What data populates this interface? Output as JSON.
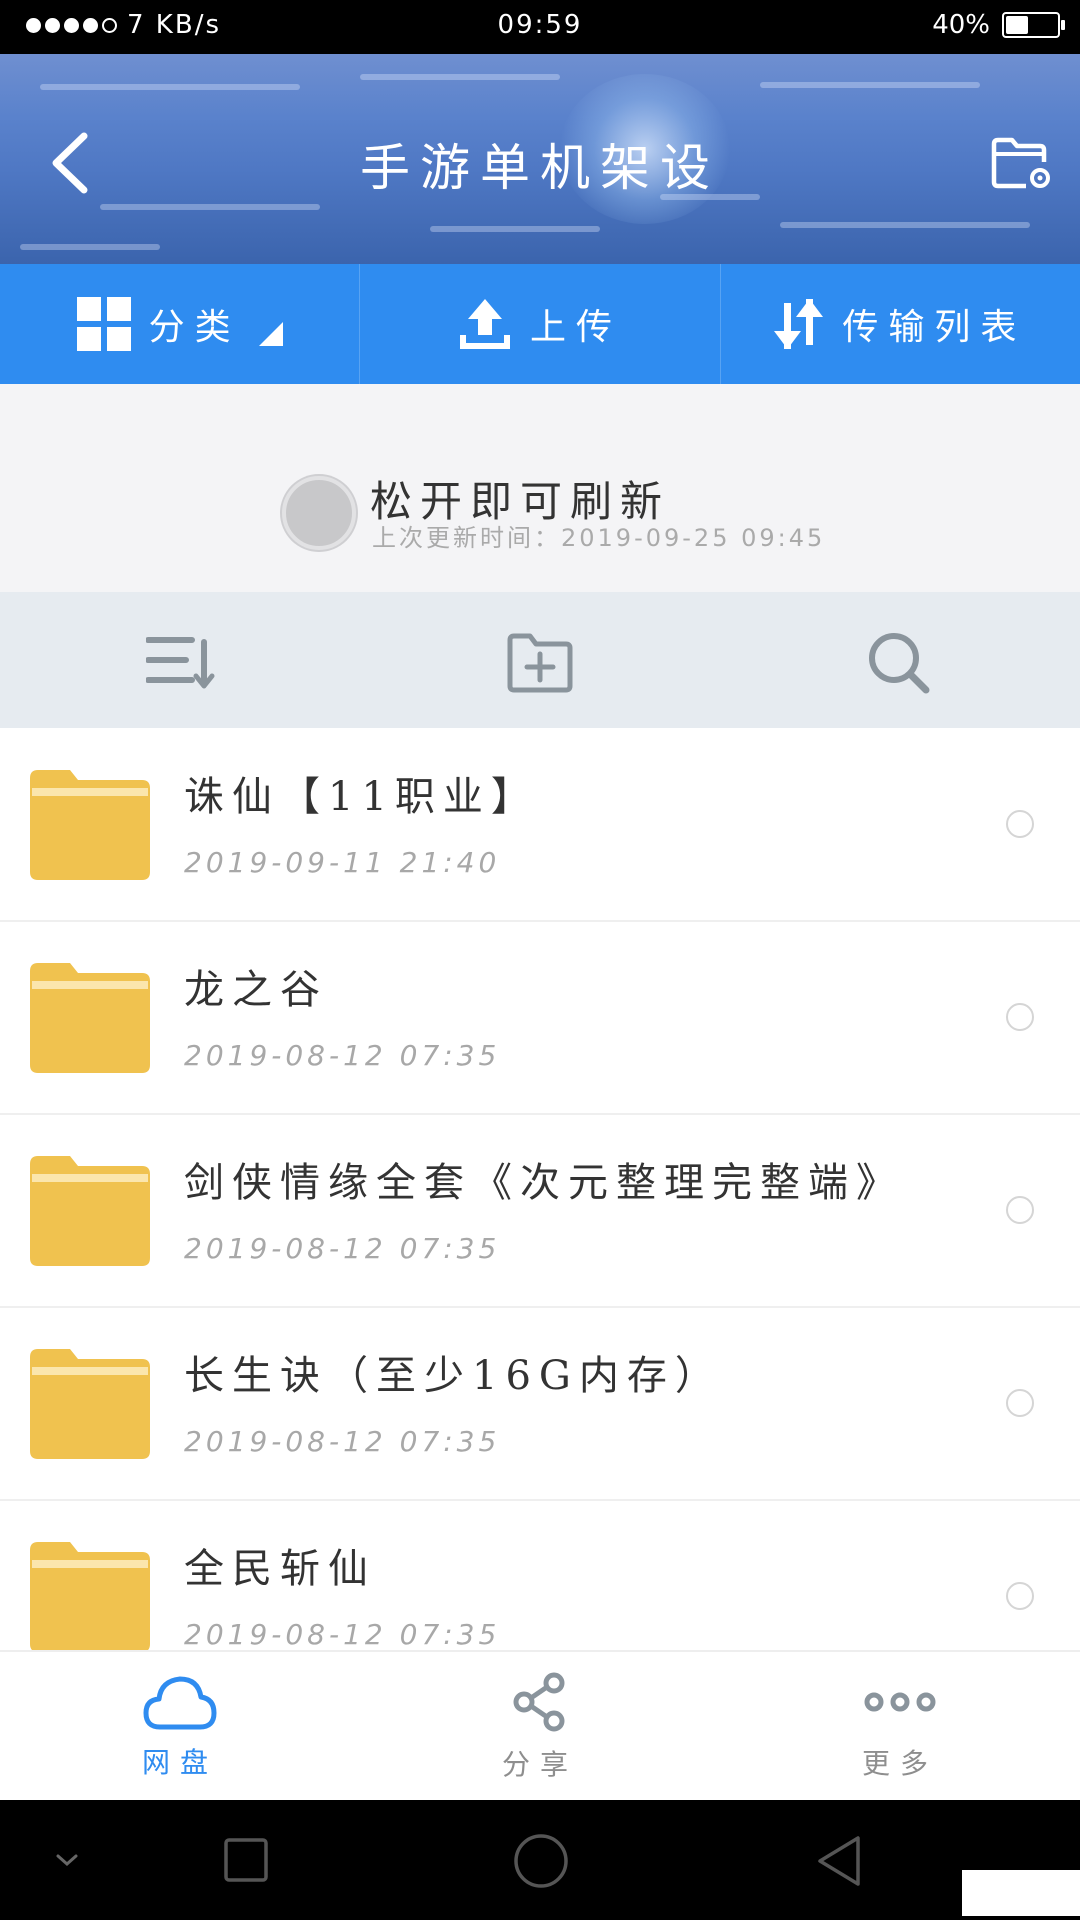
{
  "status_bar": {
    "speed": "7 KB/s",
    "time": "09:59",
    "battery_percent": "40%",
    "battery_level": 0.4
  },
  "header": {
    "title": "手游单机架设",
    "back_icon": "chevron-left-icon",
    "settings_icon": "folder-settings-icon"
  },
  "tabs": [
    {
      "label": "分类",
      "icon": "grid-icon"
    },
    {
      "label": "上传",
      "icon": "upload-icon"
    },
    {
      "label": "传输列表",
      "icon": "transfer-icon"
    }
  ],
  "refresh": {
    "title": "松开即可刷新",
    "subtitle": "上次更新时间：2019-09-25 09:45"
  },
  "toolbar": {
    "sort_icon": "sort-icon",
    "new_folder_icon": "add-folder-icon",
    "search_icon": "search-icon"
  },
  "files": [
    {
      "name": "诛仙【11职业】",
      "date": "2019-09-11  21:40"
    },
    {
      "name": "龙之谷",
      "date": "2019-08-12  07:35"
    },
    {
      "name": "剑侠情缘全套《次元整理完整端》",
      "date": "2019-08-12  07:35"
    },
    {
      "name": "长生诀（至少16G内存）",
      "date": "2019-08-12  07:35"
    },
    {
      "name": "全民斩仙",
      "date": "2019-08-12  07:35"
    }
  ],
  "bottom_nav": [
    {
      "label": "网盘",
      "icon": "cloud-icon",
      "active": true
    },
    {
      "label": "分享",
      "icon": "share-icon",
      "active": false
    },
    {
      "label": "更多",
      "icon": "more-icon",
      "active": false
    }
  ],
  "colors": {
    "accent": "#2f8cf0",
    "folder": "#f0c24f",
    "header": "#4f78c4"
  }
}
